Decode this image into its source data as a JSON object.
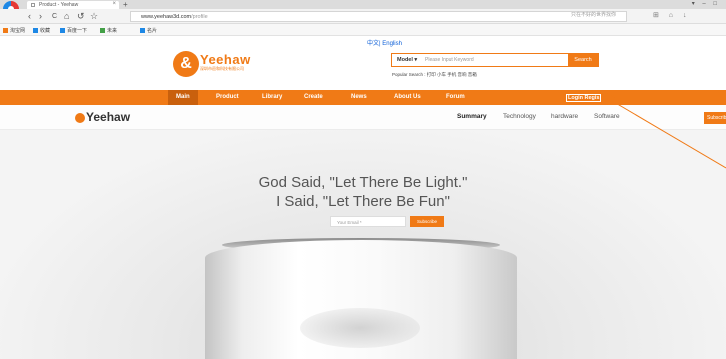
{
  "browser": {
    "tab_title": "Product - Yeehaw",
    "tab_close": "×",
    "new_tab": "+",
    "window_controls": "▾ – □",
    "url_host": "www.yeehaw3d.com",
    "url_path": "/profile",
    "search_hint": "只在不好的世界找你",
    "nav": {
      "back": "‹",
      "forward": "›",
      "reload": "C",
      "home": "⌂",
      "history": "↺",
      "star": "☆"
    },
    "right_icons": "⊞ ⌂ ↓"
  },
  "bookmarks": [
    {
      "label": "淘宝网",
      "color": "#f07a16"
    },
    {
      "label": "收藏",
      "color": "#1e88e5"
    },
    {
      "label": "百度一下",
      "color": "#1e88e5"
    },
    {
      "label": "未来",
      "color": "#43a047"
    },
    {
      "label": "名片",
      "color": "#1e88e5"
    }
  ],
  "header": {
    "language": "中文| English",
    "brand": "Yeehaw",
    "brand_sub": "深圳市邑和科技有限公司",
    "search": {
      "model_label": "Model",
      "placeholder": "Please Input Keyword",
      "button": "Search"
    },
    "popular_search": "Popular Search : 打印  小车  手机  音响  音箱"
  },
  "main_nav": {
    "items": [
      "Main",
      "Product",
      "Library",
      "Create",
      "News",
      "About Us",
      "Forum"
    ],
    "active": "Main",
    "login": "Login Regis"
  },
  "sub_nav": {
    "brand": "Yeehaw",
    "links": [
      "Summary",
      "Technology",
      "hardware",
      "Software"
    ],
    "active": "Summary",
    "subscribe_tab": "Subscribe"
  },
  "hero": {
    "line1": "God Said, \"Let There Be Light.\"",
    "line2": "I Said, \"Let There Be Fun\"",
    "email_placeholder": "Your Email *",
    "subscribe": "Subscribe"
  },
  "colors": {
    "accent": "#f07a16",
    "nav_active": "#c9600d",
    "link_blue": "#0b5ed7"
  }
}
